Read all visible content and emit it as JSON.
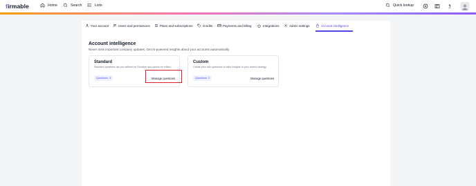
{
  "app": {
    "logo_prefix": "f",
    "logo_text": "irmable"
  },
  "topnav": {
    "home": "Home",
    "search": "Search",
    "lists": "Lists",
    "quick_lookup": "Quick lookup"
  },
  "tabs": [
    {
      "label": "Your account",
      "icon": "user-icon"
    },
    {
      "label": "Users and permissions",
      "icon": "users-icon"
    },
    {
      "label": "Plans and subscriptions",
      "icon": "list-icon"
    },
    {
      "label": "Credits",
      "icon": "tag-icon"
    },
    {
      "label": "Payments and billing",
      "icon": "card-icon"
    },
    {
      "label": "Integrations",
      "icon": "puzzle-icon"
    },
    {
      "label": "Admin settings",
      "icon": "gear-icon"
    },
    {
      "label": "Account intelligence",
      "icon": "lock-icon",
      "active": true
    }
  ],
  "page": {
    "title": "Account intelligence",
    "subtitle": "Never miss important company updates. Get AI-powered insights about your accounts automatically."
  },
  "cards": {
    "standard": {
      "title": "Standard",
      "description": "Standard questions are pre-defined by Firmable and cannot be edited.",
      "badge_label": "Questions",
      "badge_count": "4",
      "button": "Manage questions"
    },
    "custom": {
      "title": "Custom",
      "description": "Create your own questions to tailor insights to your team's strategy.",
      "badge_label": "Questions",
      "badge_count": "2",
      "button": "Manage questions"
    }
  },
  "colors": {
    "accent": "#4f46e5",
    "highlight": "#e11d28"
  }
}
